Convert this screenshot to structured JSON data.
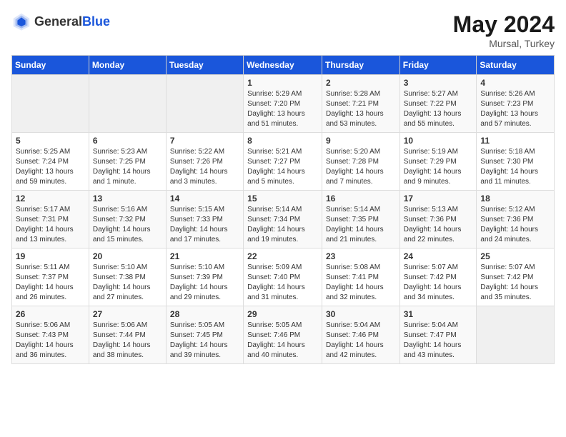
{
  "logo": {
    "text_general": "General",
    "text_blue": "Blue"
  },
  "title": {
    "month_year": "May 2024",
    "location": "Mursal, Turkey"
  },
  "weekdays": [
    "Sunday",
    "Monday",
    "Tuesday",
    "Wednesday",
    "Thursday",
    "Friday",
    "Saturday"
  ],
  "weeks": [
    [
      {
        "day": "",
        "sunrise": "",
        "sunset": "",
        "daylight": ""
      },
      {
        "day": "",
        "sunrise": "",
        "sunset": "",
        "daylight": ""
      },
      {
        "day": "",
        "sunrise": "",
        "sunset": "",
        "daylight": ""
      },
      {
        "day": "1",
        "sunrise": "Sunrise: 5:29 AM",
        "sunset": "Sunset: 7:20 PM",
        "daylight": "Daylight: 13 hours and 51 minutes."
      },
      {
        "day": "2",
        "sunrise": "Sunrise: 5:28 AM",
        "sunset": "Sunset: 7:21 PM",
        "daylight": "Daylight: 13 hours and 53 minutes."
      },
      {
        "day": "3",
        "sunrise": "Sunrise: 5:27 AM",
        "sunset": "Sunset: 7:22 PM",
        "daylight": "Daylight: 13 hours and 55 minutes."
      },
      {
        "day": "4",
        "sunrise": "Sunrise: 5:26 AM",
        "sunset": "Sunset: 7:23 PM",
        "daylight": "Daylight: 13 hours and 57 minutes."
      }
    ],
    [
      {
        "day": "5",
        "sunrise": "Sunrise: 5:25 AM",
        "sunset": "Sunset: 7:24 PM",
        "daylight": "Daylight: 13 hours and 59 minutes."
      },
      {
        "day": "6",
        "sunrise": "Sunrise: 5:23 AM",
        "sunset": "Sunset: 7:25 PM",
        "daylight": "Daylight: 14 hours and 1 minute."
      },
      {
        "day": "7",
        "sunrise": "Sunrise: 5:22 AM",
        "sunset": "Sunset: 7:26 PM",
        "daylight": "Daylight: 14 hours and 3 minutes."
      },
      {
        "day": "8",
        "sunrise": "Sunrise: 5:21 AM",
        "sunset": "Sunset: 7:27 PM",
        "daylight": "Daylight: 14 hours and 5 minutes."
      },
      {
        "day": "9",
        "sunrise": "Sunrise: 5:20 AM",
        "sunset": "Sunset: 7:28 PM",
        "daylight": "Daylight: 14 hours and 7 minutes."
      },
      {
        "day": "10",
        "sunrise": "Sunrise: 5:19 AM",
        "sunset": "Sunset: 7:29 PM",
        "daylight": "Daylight: 14 hours and 9 minutes."
      },
      {
        "day": "11",
        "sunrise": "Sunrise: 5:18 AM",
        "sunset": "Sunset: 7:30 PM",
        "daylight": "Daylight: 14 hours and 11 minutes."
      }
    ],
    [
      {
        "day": "12",
        "sunrise": "Sunrise: 5:17 AM",
        "sunset": "Sunset: 7:31 PM",
        "daylight": "Daylight: 14 hours and 13 minutes."
      },
      {
        "day": "13",
        "sunrise": "Sunrise: 5:16 AM",
        "sunset": "Sunset: 7:32 PM",
        "daylight": "Daylight: 14 hours and 15 minutes."
      },
      {
        "day": "14",
        "sunrise": "Sunrise: 5:15 AM",
        "sunset": "Sunset: 7:33 PM",
        "daylight": "Daylight: 14 hours and 17 minutes."
      },
      {
        "day": "15",
        "sunrise": "Sunrise: 5:14 AM",
        "sunset": "Sunset: 7:34 PM",
        "daylight": "Daylight: 14 hours and 19 minutes."
      },
      {
        "day": "16",
        "sunrise": "Sunrise: 5:14 AM",
        "sunset": "Sunset: 7:35 PM",
        "daylight": "Daylight: 14 hours and 21 minutes."
      },
      {
        "day": "17",
        "sunrise": "Sunrise: 5:13 AM",
        "sunset": "Sunset: 7:36 PM",
        "daylight": "Daylight: 14 hours and 22 minutes."
      },
      {
        "day": "18",
        "sunrise": "Sunrise: 5:12 AM",
        "sunset": "Sunset: 7:36 PM",
        "daylight": "Daylight: 14 hours and 24 minutes."
      }
    ],
    [
      {
        "day": "19",
        "sunrise": "Sunrise: 5:11 AM",
        "sunset": "Sunset: 7:37 PM",
        "daylight": "Daylight: 14 hours and 26 minutes."
      },
      {
        "day": "20",
        "sunrise": "Sunrise: 5:10 AM",
        "sunset": "Sunset: 7:38 PM",
        "daylight": "Daylight: 14 hours and 27 minutes."
      },
      {
        "day": "21",
        "sunrise": "Sunrise: 5:10 AM",
        "sunset": "Sunset: 7:39 PM",
        "daylight": "Daylight: 14 hours and 29 minutes."
      },
      {
        "day": "22",
        "sunrise": "Sunrise: 5:09 AM",
        "sunset": "Sunset: 7:40 PM",
        "daylight": "Daylight: 14 hours and 31 minutes."
      },
      {
        "day": "23",
        "sunrise": "Sunrise: 5:08 AM",
        "sunset": "Sunset: 7:41 PM",
        "daylight": "Daylight: 14 hours and 32 minutes."
      },
      {
        "day": "24",
        "sunrise": "Sunrise: 5:07 AM",
        "sunset": "Sunset: 7:42 PM",
        "daylight": "Daylight: 14 hours and 34 minutes."
      },
      {
        "day": "25",
        "sunrise": "Sunrise: 5:07 AM",
        "sunset": "Sunset: 7:42 PM",
        "daylight": "Daylight: 14 hours and 35 minutes."
      }
    ],
    [
      {
        "day": "26",
        "sunrise": "Sunrise: 5:06 AM",
        "sunset": "Sunset: 7:43 PM",
        "daylight": "Daylight: 14 hours and 36 minutes."
      },
      {
        "day": "27",
        "sunrise": "Sunrise: 5:06 AM",
        "sunset": "Sunset: 7:44 PM",
        "daylight": "Daylight: 14 hours and 38 minutes."
      },
      {
        "day": "28",
        "sunrise": "Sunrise: 5:05 AM",
        "sunset": "Sunset: 7:45 PM",
        "daylight": "Daylight: 14 hours and 39 minutes."
      },
      {
        "day": "29",
        "sunrise": "Sunrise: 5:05 AM",
        "sunset": "Sunset: 7:46 PM",
        "daylight": "Daylight: 14 hours and 40 minutes."
      },
      {
        "day": "30",
        "sunrise": "Sunrise: 5:04 AM",
        "sunset": "Sunset: 7:46 PM",
        "daylight": "Daylight: 14 hours and 42 minutes."
      },
      {
        "day": "31",
        "sunrise": "Sunrise: 5:04 AM",
        "sunset": "Sunset: 7:47 PM",
        "daylight": "Daylight: 14 hours and 43 minutes."
      },
      {
        "day": "",
        "sunrise": "",
        "sunset": "",
        "daylight": ""
      }
    ]
  ]
}
